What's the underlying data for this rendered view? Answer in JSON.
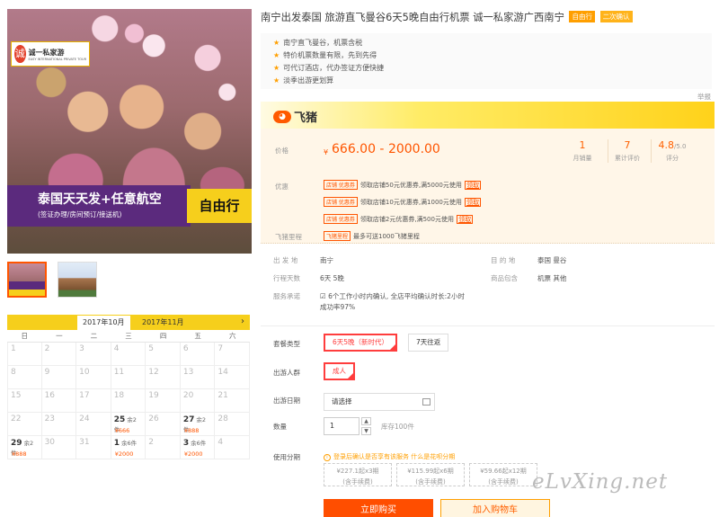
{
  "product": {
    "title": "南宁出发泰国 旅游直飞曼谷6天5晚自由行机票 诚一私家游广西南宁",
    "tags": [
      "自由行",
      "二次确认"
    ],
    "bullets": [
      "南宁直飞曼谷，机票含税",
      "特价机票数量有限，先到先得",
      "可代订酒店，代办签证方便快捷",
      "淡季出游更划算"
    ],
    "report_label": "举报"
  },
  "image": {
    "logo_text": "诚一私家游",
    "logo_seal": "诚",
    "logo_sub": "EASY INTERNATIONAL PRIVATE TOUR",
    "banner_line1": "泰国天天发+任意航空",
    "banner_line2": "(签证办理/房间预订/接送机)",
    "banner_tag": "自由行"
  },
  "brand": {
    "name": "飞猪",
    "icon": "fliggy-logo-icon"
  },
  "price": {
    "label": "价格",
    "currency": "¥",
    "range": "666.00 - 2000.00",
    "stats": [
      {
        "value": "1",
        "label": "月销量"
      },
      {
        "value": "7",
        "label": "累计评价"
      },
      {
        "value": "4.8",
        "suffix": "/5.0",
        "label": "评分"
      }
    ]
  },
  "promo": {
    "label": "优惠",
    "coupon_tag": "店铺 优惠券",
    "coupons": [
      "领取店铺50元优惠券,满5000元使用",
      "领取店铺10元优惠券,满1000元使用",
      "领取店铺2元优惠券,满500元使用"
    ],
    "get_label": "领取",
    "mileage_label": "飞猪里程",
    "mileage_tag": "飞猪里程",
    "mileage_text": "最多可送1000飞猪里程"
  },
  "info": {
    "depart_label": "出 发 地",
    "depart_value": "南宁",
    "dest_label": "目 的 地",
    "dest_value": "泰国  曼谷",
    "days_label": "行程天数",
    "days_value": "6天  5晚",
    "includes_label": "商品包含",
    "includes_value": "机票  其他",
    "service_label": "服务承诺",
    "service_line1": "6个工作小时内确认, 全店平均确认时长:2小时",
    "service_line2": "成功率97%"
  },
  "options": {
    "package_label": "套餐类型",
    "packages": [
      "6天5晚（新时代）",
      "7天往返"
    ],
    "crowd_label": "出游人群",
    "crowd": "成人",
    "date_label": "出游日期",
    "date_placeholder": "请选择",
    "qty_label": "数量",
    "qty_value": "1",
    "stock_text": "库存100件",
    "installment_label": "使用分期",
    "installment_note": "登录后确认是否享有该服务",
    "installment_what": "什么是花呗分期",
    "installment_plans": [
      {
        "amount": "¥227.1起x3期",
        "fee": "(含手续费)"
      },
      {
        "amount": "¥115.99起x6期",
        "fee": "(含手续费)"
      },
      {
        "amount": "¥59.66起x12期",
        "fee": "(含手续费)"
      }
    ]
  },
  "actions": {
    "buy": "立即购买",
    "cart": "加入购物车"
  },
  "calendar": {
    "months": [
      "2017年10月",
      "2017年11月"
    ],
    "next_icon": "chevron-right-icon",
    "weekdays": [
      "日",
      "一",
      "二",
      "三",
      "四",
      "五",
      "六"
    ],
    "days": [
      {
        "d": "1"
      },
      {
        "d": "2"
      },
      {
        "d": "3"
      },
      {
        "d": "4"
      },
      {
        "d": "5"
      },
      {
        "d": "6"
      },
      {
        "d": "7"
      },
      {
        "d": "8"
      },
      {
        "d": "9"
      },
      {
        "d": "10"
      },
      {
        "d": "11"
      },
      {
        "d": "12"
      },
      {
        "d": "13"
      },
      {
        "d": "14"
      },
      {
        "d": "15"
      },
      {
        "d": "16"
      },
      {
        "d": "17"
      },
      {
        "d": "18"
      },
      {
        "d": "19"
      },
      {
        "d": "20"
      },
      {
        "d": "21"
      },
      {
        "d": "22"
      },
      {
        "d": "23"
      },
      {
        "d": "24"
      },
      {
        "d": "25",
        "stock": "余2件",
        "price": "¥666"
      },
      {
        "d": "26"
      },
      {
        "d": "27",
        "stock": "余2件",
        "price": "¥888"
      },
      {
        "d": "28"
      },
      {
        "d": "29",
        "stock": "余2件",
        "price": "¥888"
      },
      {
        "d": "30"
      },
      {
        "d": "31"
      },
      {
        "d": "1",
        "stock": "余6件",
        "price": "¥2000"
      },
      {
        "d": "2"
      },
      {
        "d": "3",
        "stock": "余6件",
        "price": "¥2000"
      },
      {
        "d": "4"
      }
    ]
  },
  "watermark": "eLvXing.net",
  "colors": {
    "accent": "#ff5500",
    "brand_yellow": "#f6cf1c",
    "banner_purple": "#5b2a7d"
  }
}
